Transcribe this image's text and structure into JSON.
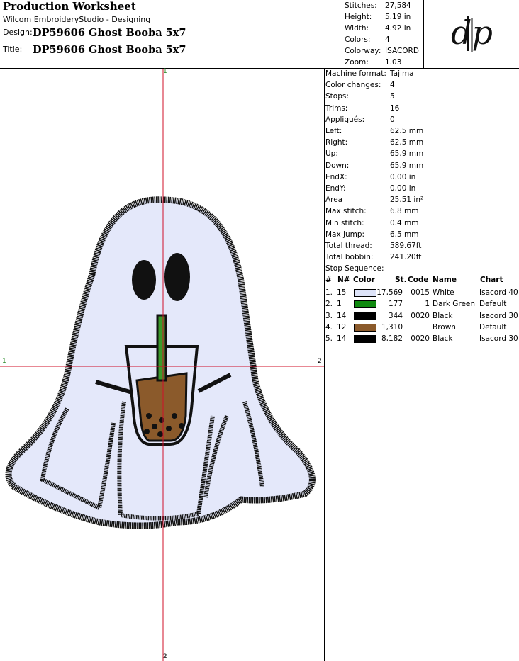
{
  "header": {
    "title": "Production Worksheet",
    "subtitle": "Wilcom EmbroideryStudio - Designing",
    "design_label": "Design:",
    "design_value": "DP59606 Ghost Booba 5x7",
    "title_label": "Title:",
    "title_value": "DP59606 Ghost Booba 5x7"
  },
  "summary": [
    {
      "label": "Stitches:",
      "value": "27,584"
    },
    {
      "label": "Height:",
      "value": "5.19 in"
    },
    {
      "label": "Width:",
      "value": "4.92 in"
    },
    {
      "label": "Colors:",
      "value": "4"
    },
    {
      "label": "Colorway:",
      "value": "ISACORD"
    },
    {
      "label": "Zoom:",
      "value": "1.03"
    }
  ],
  "logo_text": "dp",
  "properties": [
    {
      "label": "Machine format:",
      "value": "Tajima"
    },
    {
      "label": "Color changes:",
      "value": "4"
    },
    {
      "label": "Stops:",
      "value": "5"
    },
    {
      "label": "Trims:",
      "value": "16"
    },
    {
      "label": "Appliqués:",
      "value": "0"
    },
    {
      "label": "Left:",
      "value": "62.5 mm"
    },
    {
      "label": "Right:",
      "value": "62.5 mm"
    },
    {
      "label": "Up:",
      "value": "65.9 mm"
    },
    {
      "label": "Down:",
      "value": "65.9 mm"
    },
    {
      "label": "EndX:",
      "value": "0.00 in"
    },
    {
      "label": "EndY:",
      "value": "0.00 in"
    },
    {
      "label": "Area",
      "value": " 25.51 in²"
    },
    {
      "label": "Max stitch:",
      "value": "6.8 mm"
    },
    {
      "label": "Min stitch:",
      "value": "0.4 mm"
    },
    {
      "label": "Max jump:",
      "value": "6.5 mm"
    },
    {
      "label": "Total thread:",
      "value": "589.67ft"
    },
    {
      "label": "Total bobbin:",
      "value": "241.20ft"
    }
  ],
  "stop_sequence": {
    "label": "Stop Sequence:",
    "columns": {
      "idx": "#",
      "n": "N#",
      "color": "Color",
      "st": "St.",
      "code": "Code",
      "name": "Name",
      "chart": "Chart"
    },
    "rows": [
      {
        "idx": "1.",
        "n": "15",
        "swatch": "#dde3f8",
        "st": "17,569",
        "code": "0015",
        "name": "White",
        "chart": "Isacord 40"
      },
      {
        "idx": "2.",
        "n": "1",
        "swatch": "#0f8a0f",
        "st": "177",
        "code": "1",
        "name": "Dark Green",
        "chart": "Default"
      },
      {
        "idx": "3.",
        "n": "14",
        "swatch": "#000000",
        "st": "344",
        "code": "0020",
        "name": "Black",
        "chart": "Isacord 30"
      },
      {
        "idx": "4.",
        "n": "12",
        "swatch": "#8b5a2b",
        "st": "1,310",
        "code": "",
        "name": "Brown",
        "chart": "Default"
      },
      {
        "idx": "5.",
        "n": "14",
        "swatch": "#000000",
        "st": "8,182",
        "code": "0020",
        "name": "Black",
        "chart": "Isacord 30"
      }
    ]
  },
  "crosshair_markers": {
    "top": "1",
    "left": "1",
    "right": "2",
    "bottom": "2"
  },
  "colors": {
    "ghost_fill": "#e4e8fa",
    "outline": "#111111",
    "crosshair": "#d0102a",
    "tea": "#8b5a2b",
    "straw": "#3a9a2a"
  }
}
